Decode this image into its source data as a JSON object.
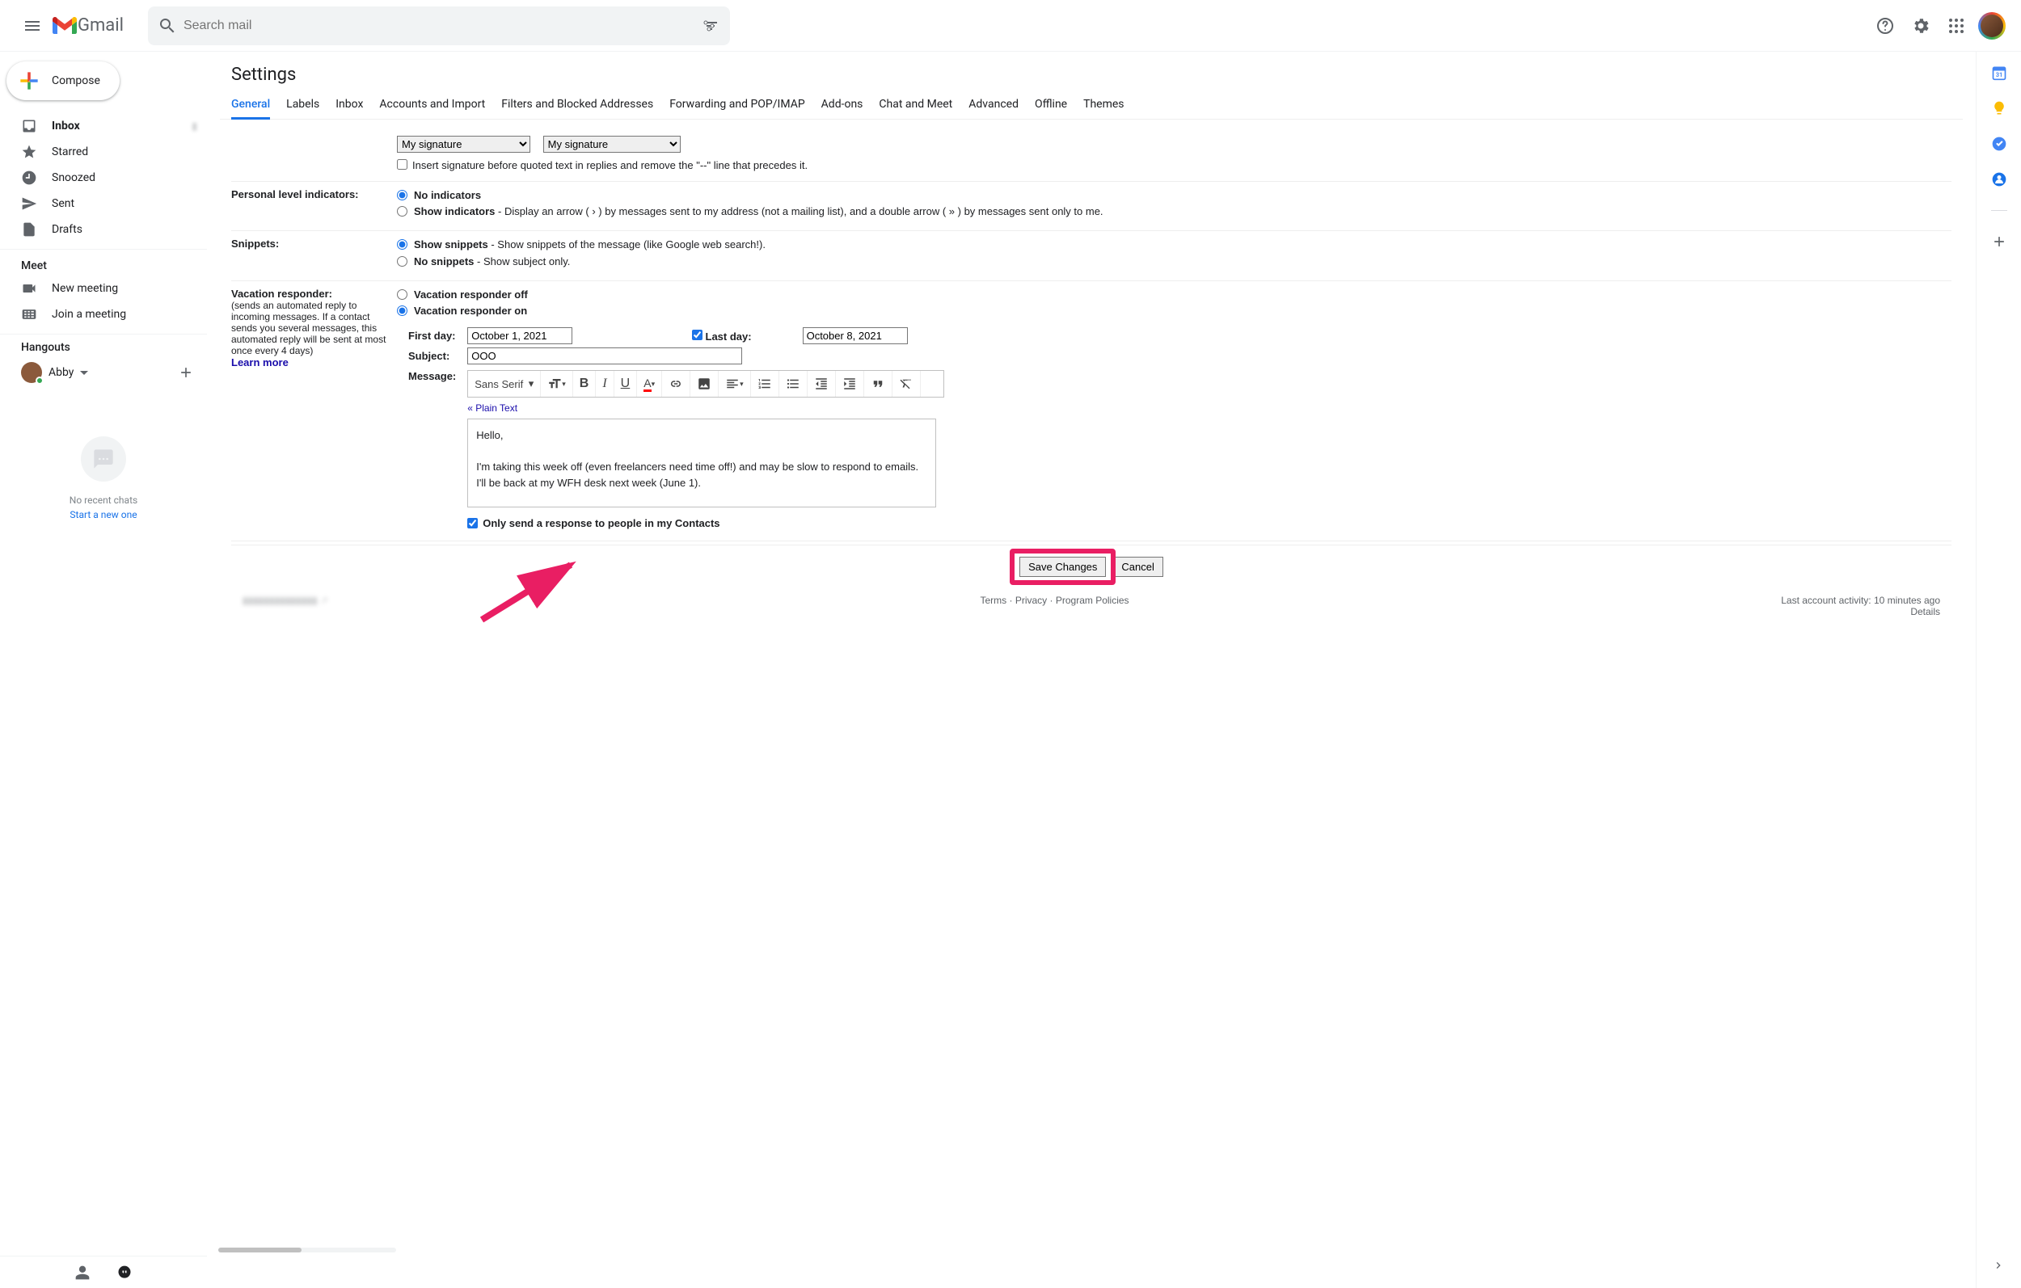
{
  "header": {
    "app_name": "Gmail",
    "search_placeholder": "Search mail"
  },
  "sidebar": {
    "compose": "Compose",
    "items": [
      {
        "label": "Inbox",
        "bold": true,
        "icon": "inbox"
      },
      {
        "label": "Starred",
        "icon": "star"
      },
      {
        "label": "Snoozed",
        "icon": "clock"
      },
      {
        "label": "Sent",
        "icon": "send"
      },
      {
        "label": "Drafts",
        "icon": "file"
      }
    ],
    "meet_label": "Meet",
    "meet_items": [
      {
        "label": "New meeting",
        "icon": "video"
      },
      {
        "label": "Join a meeting",
        "icon": "keyboard"
      }
    ],
    "hangouts_label": "Hangouts",
    "hangouts_user": "Abby",
    "no_chats": "No recent chats",
    "start_new": "Start a new one"
  },
  "settings": {
    "title": "Settings",
    "tabs": [
      "General",
      "Labels",
      "Inbox",
      "Accounts and Import",
      "Filters and Blocked Addresses",
      "Forwarding and POP/IMAP",
      "Add-ons",
      "Chat and Meet",
      "Advanced",
      "Offline",
      "Themes"
    ],
    "active_tab": "General",
    "signature_selects": [
      "My signature",
      "My signature"
    ],
    "signature_checkbox": "Insert signature before quoted text in replies and remove the \"--\" line that precedes it.",
    "rows": {
      "personal_indicators": {
        "label": "Personal level indicators:",
        "opt1": "No indicators",
        "opt2_bold": "Show indicators",
        "opt2_rest": " - Display an arrow ( › ) by messages sent to my address (not a mailing list), and a double arrow ( » ) by messages sent only to me."
      },
      "snippets": {
        "label": "Snippets:",
        "opt1_bold": "Show snippets",
        "opt1_rest": " - Show snippets of the message (like Google web search!).",
        "opt2_bold": "No snippets",
        "opt2_rest": " - Show subject only."
      },
      "vacation": {
        "label": "Vacation responder:",
        "sub": "(sends an automated reply to incoming messages. If a contact sends you several messages, this automated reply will be sent at most once every 4 days)",
        "learn_more": "Learn more",
        "off": "Vacation responder off",
        "on": "Vacation responder on",
        "first_day_label": "First day:",
        "first_day": "October 1, 2021",
        "last_day_label": "Last day:",
        "last_day": "October 8, 2021",
        "subject_label": "Subject:",
        "subject": "OOO",
        "message_label": "Message:",
        "font": "Sans Serif",
        "plain_text": "« Plain Text",
        "body_greeting": "Hello,",
        "body_text": "I'm taking this week off (even freelancers need time off!) and may be slow to respond to emails. I'll be back at my WFH desk next week (June 1).",
        "contacts_only": "Only send a response to people in my Contacts"
      }
    },
    "save_btn": "Save Changes",
    "cancel_btn": "Cancel"
  },
  "footer": {
    "terms": "Terms",
    "privacy": "Privacy",
    "policies": "Program Policies",
    "activity": "Last account activity: 10 minutes ago",
    "details": "Details"
  }
}
